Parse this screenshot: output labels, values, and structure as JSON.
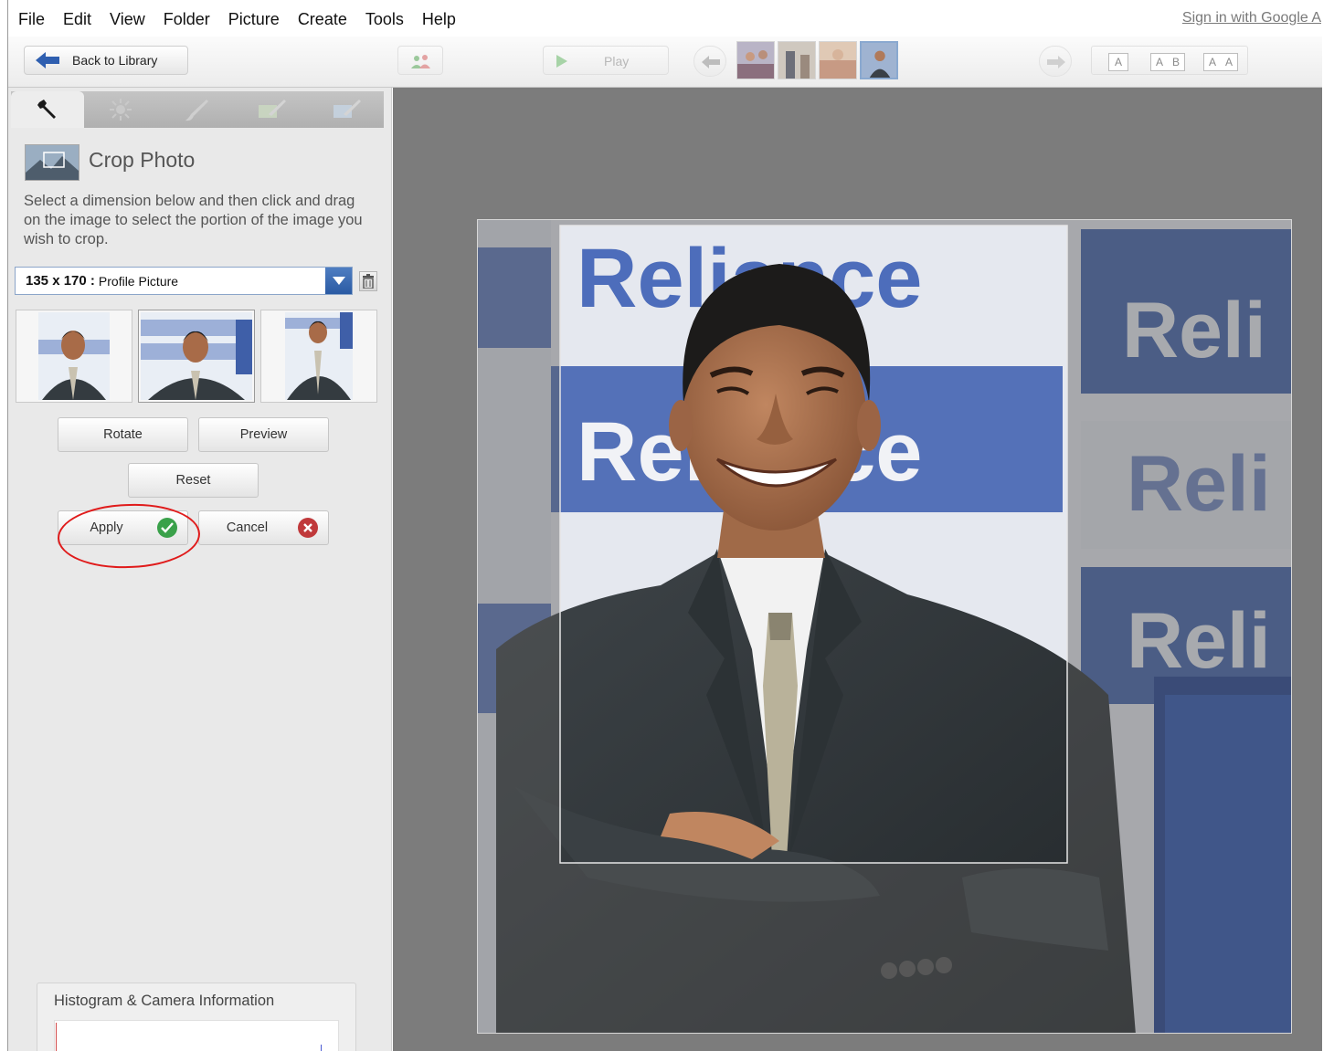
{
  "menu": [
    "File",
    "Edit",
    "View",
    "Folder",
    "Picture",
    "Create",
    "Tools",
    "Help"
  ],
  "signin": "Sign in with Google A",
  "toolbar": {
    "back_label": "Back to Library",
    "play_label": "Play",
    "compare_modes": [
      "A",
      "A",
      "B",
      "A",
      "A"
    ]
  },
  "panel": {
    "tabs": [
      "wrench-icon",
      "sun-icon",
      "brush-icon",
      "brush2-icon",
      "brush3-icon"
    ],
    "title": "Crop Photo",
    "description": "Select a dimension below and then click and drag on the image to select the portion of the image you wish to crop.",
    "dimension_value": "135 x 170 :",
    "dimension_name": "Profile Picture",
    "buttons": {
      "rotate": "Rotate",
      "preview": "Preview",
      "reset": "Reset",
      "apply": "Apply",
      "cancel": "Cancel"
    },
    "histogram_title": "Histogram & Camera Information"
  },
  "photo": {
    "banner_text": "Reliance",
    "banner_partial": "Reli"
  },
  "colors": {
    "accent_blue": "#2a5aa3",
    "apply_green": "#3aa14a",
    "cancel_red": "#c0393b",
    "annotation_red": "#e01b1b"
  }
}
